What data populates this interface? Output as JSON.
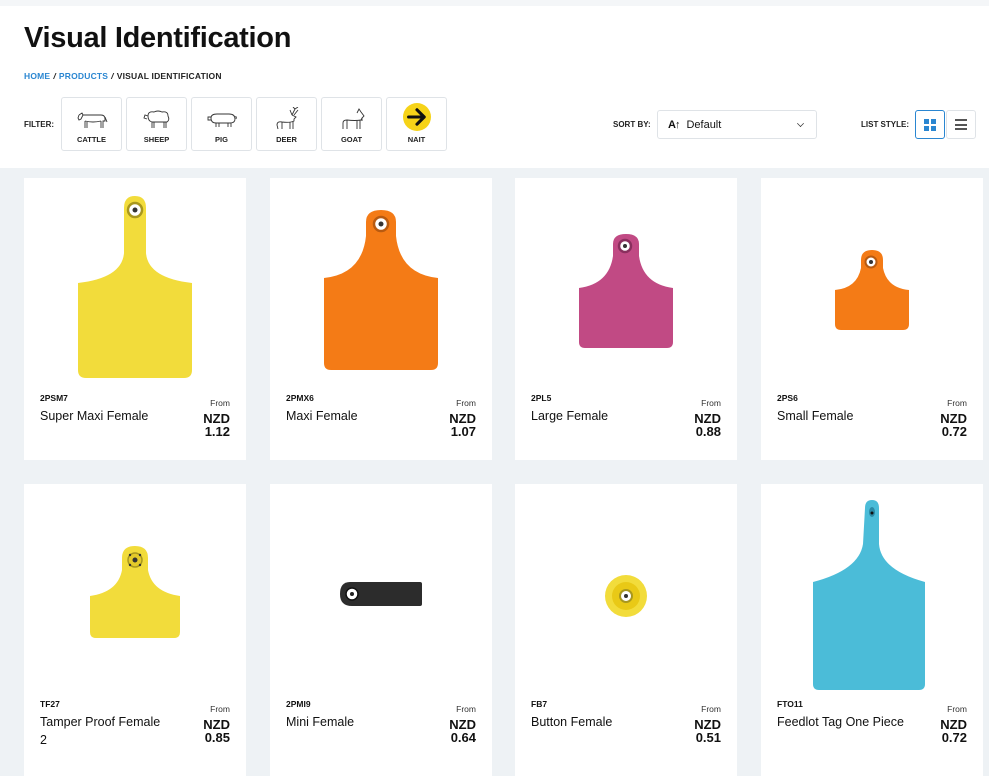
{
  "page": {
    "title": "Visual Identification"
  },
  "breadcrumb": {
    "home": "HOME",
    "products": "PRODUCTS",
    "current": "VISUAL IDENTIFICATION",
    "separator": "/"
  },
  "filter": {
    "label": "FILTER:",
    "options": [
      {
        "label": "CATTLE",
        "icon": "cattle-icon"
      },
      {
        "label": "SHEEP",
        "icon": "sheep-icon"
      },
      {
        "label": "PIG",
        "icon": "pig-icon"
      },
      {
        "label": "DEER",
        "icon": "deer-icon"
      },
      {
        "label": "GOAT",
        "icon": "goat-icon"
      },
      {
        "label": "NAIT",
        "icon": "arrow-right-icon"
      }
    ]
  },
  "sort": {
    "label": "SORT BY:",
    "value": "Default",
    "icon": "sort-az-icon"
  },
  "list_style": {
    "label": "LIST STYLE:",
    "active": "grid"
  },
  "products": [
    {
      "code": "2PSM7",
      "name": "Super Maxi Female",
      "from": "From",
      "currency": "NZD",
      "price": "1.12",
      "color": "#f2dc3b"
    },
    {
      "code": "2PMX6",
      "name": "Maxi Female",
      "from": "From",
      "currency": "NZD",
      "price": "1.07",
      "color": "#f47b16"
    },
    {
      "code": "2PL5",
      "name": "Large Female",
      "from": "From",
      "currency": "NZD",
      "price": "0.88",
      "color": "#c14a84"
    },
    {
      "code": "2PS6",
      "name": "Small Female",
      "from": "From",
      "currency": "NZD",
      "price": "0.72",
      "color": "#f47b16"
    },
    {
      "code": "TF27",
      "name": "Tamper Proof Female 2",
      "from": "From",
      "currency": "NZD",
      "price": "0.85",
      "color": "#f2dc3b"
    },
    {
      "code": "2PMI9",
      "name": "Mini Female",
      "from": "From",
      "currency": "NZD",
      "price": "0.64",
      "color": "#2c2c2c"
    },
    {
      "code": "FB7",
      "name": "Button Female",
      "from": "From",
      "currency": "NZD",
      "price": "0.51",
      "color": "#f2dc3b"
    },
    {
      "code": "FTO11",
      "name": "Feedlot Tag One Piece",
      "from": "From",
      "currency": "NZD",
      "price": "0.72",
      "color": "#4bbcd8"
    }
  ]
}
